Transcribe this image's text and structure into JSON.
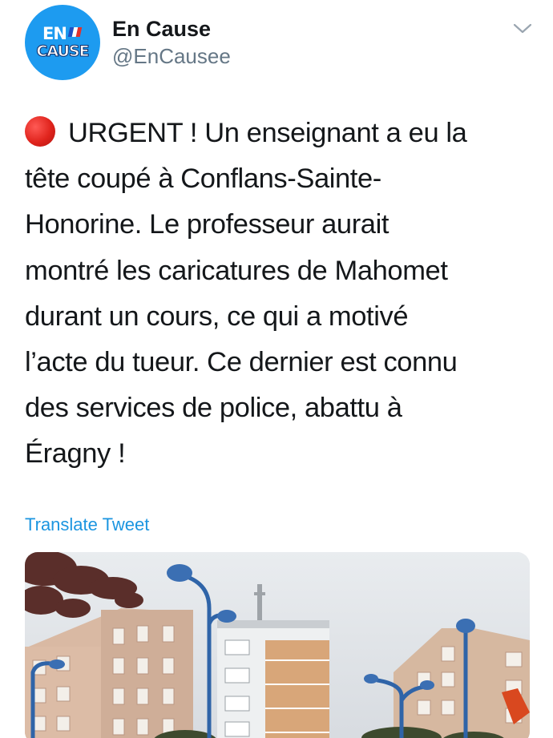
{
  "tweet": {
    "author": {
      "display_name": "En Cause",
      "handle": "@EnCausee",
      "avatar": {
        "line1": "EN",
        "line2": "CAUSE",
        "background": "#1d9bf0"
      }
    },
    "menu_icon": "chevron-down-icon",
    "status_icon": "red-circle-emoji",
    "text_lines": [
      "URGENT ! Un enseignant a eu la",
      "tête coupé à Conflans-Sainte-",
      "Honorine. Le professeur aurait",
      "montré les caricatures de Mahomet",
      "durant un cours, ce qui a motivé",
      "l’acte du tueur. Ce dernier est connu",
      "des services de police, abattu à",
      "Éragny !"
    ],
    "translate_label": "Translate Tweet",
    "media": {
      "description_icon": "photo-buildings-street-lamps"
    }
  },
  "colors": {
    "accent": "#1b95e0",
    "text": "#14171a",
    "secondary_text": "#657786",
    "alert_red": "#e0241d"
  }
}
